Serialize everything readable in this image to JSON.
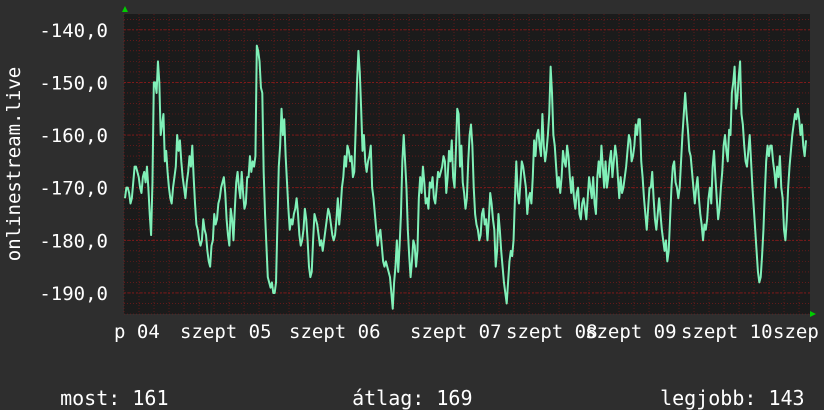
{
  "colors": {
    "background": "#2e2e2e",
    "plot_bg": "#1b1b1b",
    "line": "#80f0b8",
    "grid": "#8b1a1a",
    "axis_marker": "#00cc00"
  },
  "chart_data": {
    "type": "line",
    "ylabel": "onlinestream.live",
    "ylim": [
      -194,
      -137
    ],
    "yticks": [
      -140,
      -150,
      -160,
      -170,
      -180,
      -190
    ],
    "ytick_labels": [
      "-140,0",
      "-150,0",
      "-160,0",
      "-170,0",
      "-180,0",
      "-190,0"
    ],
    "xtick_labels": [
      "p 04",
      "szept 05",
      "szept 06",
      "szept 07",
      "szept 08",
      "szept 09",
      "szept 10",
      "szep"
    ],
    "series": [
      {
        "values": [
          -172,
          -170,
          -170,
          -171,
          -173,
          -172,
          -169,
          -166,
          -166,
          -167,
          -168,
          -170,
          -171,
          -168,
          -167,
          -169,
          -166,
          -170,
          -175,
          -179,
          -169,
          -150,
          -150,
          -152,
          -146,
          -150,
          -160,
          -158,
          -156,
          -165,
          -163,
          -167,
          -170,
          -172,
          -173,
          -170,
          -168,
          -166,
          -160,
          -163,
          -161,
          -165,
          -168,
          -170,
          -172,
          -169,
          -167,
          -164,
          -166,
          -162,
          -168,
          -173,
          -177,
          -178,
          -180,
          -181,
          -180,
          -176,
          -178,
          -179,
          -182,
          -184,
          -185,
          -181,
          -180,
          -175,
          -177,
          -176,
          -173,
          -172,
          -170,
          -169,
          -168,
          -171,
          -176,
          -179,
          -181,
          -174,
          -176,
          -180,
          -174,
          -169,
          -167,
          -170,
          -172,
          -167,
          -171,
          -174,
          -173,
          -168,
          -168,
          -164,
          -167,
          -165,
          -166,
          -164,
          -143,
          -144,
          -146,
          -151,
          -152,
          -167,
          -175,
          -181,
          -187,
          -188,
          -189,
          -188,
          -190,
          -190,
          -188,
          -177,
          -166,
          -162,
          -155,
          -160,
          -157,
          -164,
          -169,
          -174,
          -178,
          -176,
          -177,
          -175,
          -174,
          -172,
          -175,
          -179,
          -181,
          -180,
          -178,
          -174,
          -176,
          -180,
          -185,
          -187,
          -186,
          -180,
          -175,
          -176,
          -177,
          -179,
          -181,
          -180,
          -182,
          -180,
          -178,
          -176,
          -174,
          -175,
          -177,
          -179,
          -180,
          -179,
          -176,
          -172,
          -177,
          -174,
          -170,
          -168,
          -164,
          -166,
          -162,
          -163,
          -165,
          -164,
          -168,
          -167,
          -159,
          -150,
          -144,
          -148,
          -155,
          -163,
          -160,
          -165,
          -167,
          -165,
          -164,
          -162,
          -170,
          -172,
          -175,
          -178,
          -181,
          -179,
          -178,
          -181,
          -184,
          -185,
          -184,
          -185,
          -186,
          -187,
          -190,
          -193,
          -188,
          -185,
          -180,
          -186,
          -181,
          -175,
          -165,
          -160,
          -165,
          -170,
          -178,
          -183,
          -187,
          -184,
          -180,
          -181,
          -185,
          -182,
          -172,
          -168,
          -171,
          -166,
          -169,
          -173,
          -172,
          -174,
          -169,
          -170,
          -168,
          -172,
          -173,
          -170,
          -167,
          -168,
          -167,
          -166,
          -164,
          -165,
          -171,
          -168,
          -163,
          -165,
          -161,
          -168,
          -170,
          -163,
          -155,
          -156,
          -166,
          -162,
          -169,
          -171,
          -174,
          -172,
          -165,
          -160,
          -158,
          -162,
          -170,
          -175,
          -177,
          -178,
          -180,
          -179,
          -175,
          -174,
          -177,
          -176,
          -180,
          -176,
          -171,
          -173,
          -176,
          -178,
          -185,
          -182,
          -175,
          -178,
          -182,
          -185,
          -188,
          -190,
          -192,
          -188,
          -184,
          -182,
          -183,
          -180,
          -172,
          -165,
          -171,
          -173,
          -169,
          -165,
          -166,
          -168,
          -170,
          -175,
          -172,
          -171,
          -173,
          -168,
          -161,
          -164,
          -160,
          -159,
          -162,
          -164,
          -156,
          -162,
          -165,
          -163,
          -160,
          -156,
          -147,
          -152,
          -160,
          -162,
          -166,
          -170,
          -168,
          -171,
          -168,
          -163,
          -165,
          -166,
          -162,
          -164,
          -168,
          -171,
          -168,
          -172,
          -174,
          -171,
          -170,
          -175,
          -176,
          -173,
          -172,
          -174,
          -176,
          -172,
          -168,
          -170,
          -172,
          -168,
          -173,
          -175,
          -168,
          -165,
          -168,
          -162,
          -166,
          -170,
          -165,
          -170,
          -168,
          -165,
          -163,
          -168,
          -165,
          -162,
          -164,
          -168,
          -172,
          -168,
          -171,
          -170,
          -168,
          -166,
          -163,
          -160,
          -161,
          -165,
          -164,
          -162,
          -158,
          -160,
          -157,
          -157,
          -165,
          -168,
          -172,
          -175,
          -178,
          -174,
          -170,
          -170,
          -167,
          -172,
          -176,
          -178,
          -175,
          -172,
          -175,
          -178,
          -180,
          -182,
          -180,
          -184,
          -182,
          -176,
          -170,
          -166,
          -165,
          -169,
          -170,
          -172,
          -170,
          -165,
          -160,
          -156,
          -152,
          -156,
          -159,
          -163,
          -164,
          -167,
          -170,
          -173,
          -170,
          -168,
          -172,
          -175,
          -177,
          -180,
          -177,
          -178,
          -176,
          -172,
          -170,
          -173,
          -166,
          -163,
          -168,
          -172,
          -176,
          -174,
          -170,
          -167,
          -162,
          -160,
          -163,
          -165,
          -159,
          -160,
          -152,
          -150,
          -147,
          -155,
          -153,
          -149,
          -146,
          -156,
          -158,
          -162,
          -165,
          -166,
          -163,
          -160,
          -165,
          -170,
          -174,
          -178,
          -182,
          -186,
          -188,
          -187,
          -183,
          -178,
          -171,
          -165,
          -162,
          -164,
          -162,
          -162,
          -165,
          -167,
          -170,
          -166,
          -168,
          -164,
          -170,
          -172,
          -178,
          -180,
          -176,
          -170,
          -166,
          -163,
          -160,
          -158,
          -156,
          -157,
          -155,
          -157,
          -160,
          -158,
          -162,
          -164,
          -161
        ]
      }
    ]
  },
  "stats": {
    "current_label": "most:",
    "current_value": "161",
    "average_label": "átlag:",
    "average_value": "169",
    "best_label": "legjobb:",
    "best_value": "143"
  }
}
